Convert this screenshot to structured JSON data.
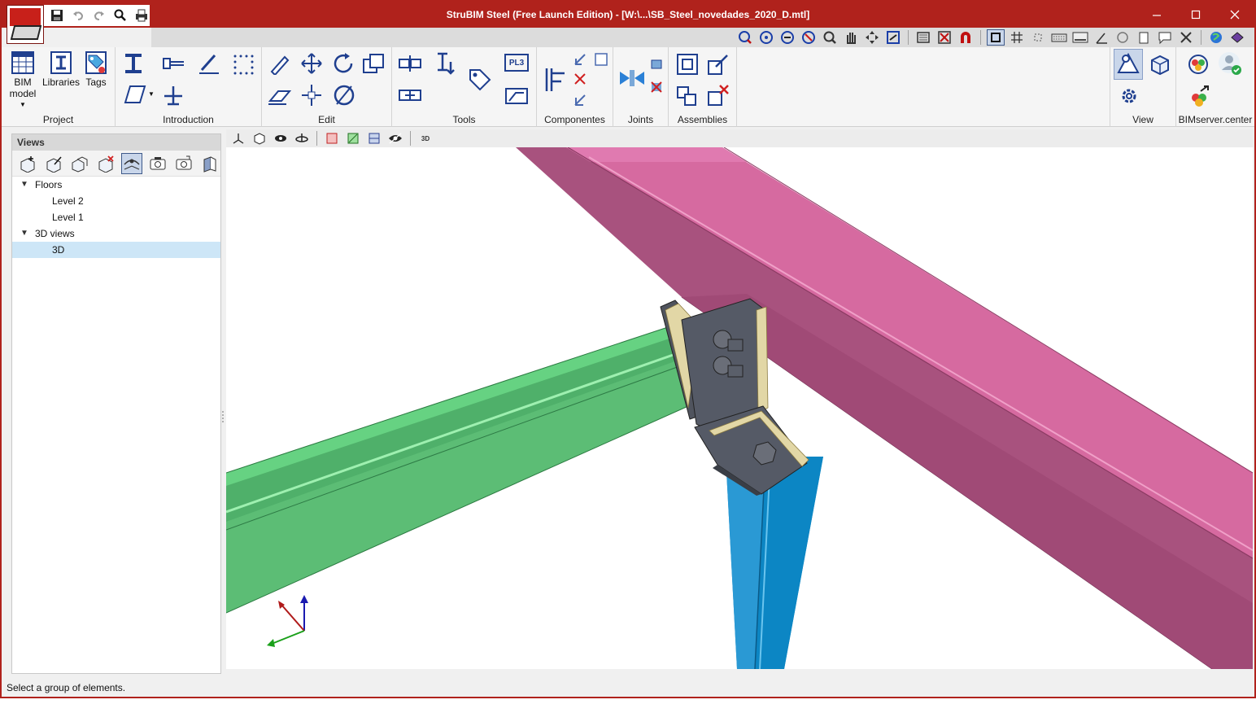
{
  "window": {
    "title": "StruBIM Steel (Free Launch Edition) - [W:\\...\\SB_Steel_novedades_2020_D.mtl]"
  },
  "ribbon": {
    "groups": [
      {
        "label": "Project"
      },
      {
        "label": "Introduction"
      },
      {
        "label": "Edit"
      },
      {
        "label": "Tools"
      },
      {
        "label": "Componentes"
      },
      {
        "label": "Joints"
      },
      {
        "label": "Assemblies"
      },
      {
        "label": "View"
      },
      {
        "label": "BIMserver.center"
      }
    ],
    "bim_model_label_1": "BIM",
    "bim_model_label_2": "model",
    "libraries_label": "Libraries",
    "tags_label": "Tags",
    "pl3_label": "PL3"
  },
  "views_panel": {
    "header": "Views",
    "tree": [
      {
        "label": "Floors",
        "level": 0,
        "expanded": true
      },
      {
        "label": "Level 2",
        "level": 1
      },
      {
        "label": "Level 1",
        "level": 1
      },
      {
        "label": "3D views",
        "level": 0,
        "expanded": true
      },
      {
        "label": "3D",
        "level": 1,
        "selected": true
      }
    ]
  },
  "viewport": {
    "mode_icon_label": "3D",
    "beam_colors": {
      "green": "#5fc078",
      "magenta": "#d66aa0",
      "blue": "#1f8fc8",
      "plate": "#555a66",
      "weld": "#e2d7a6"
    }
  },
  "status": {
    "message": "Select a group of elements."
  }
}
